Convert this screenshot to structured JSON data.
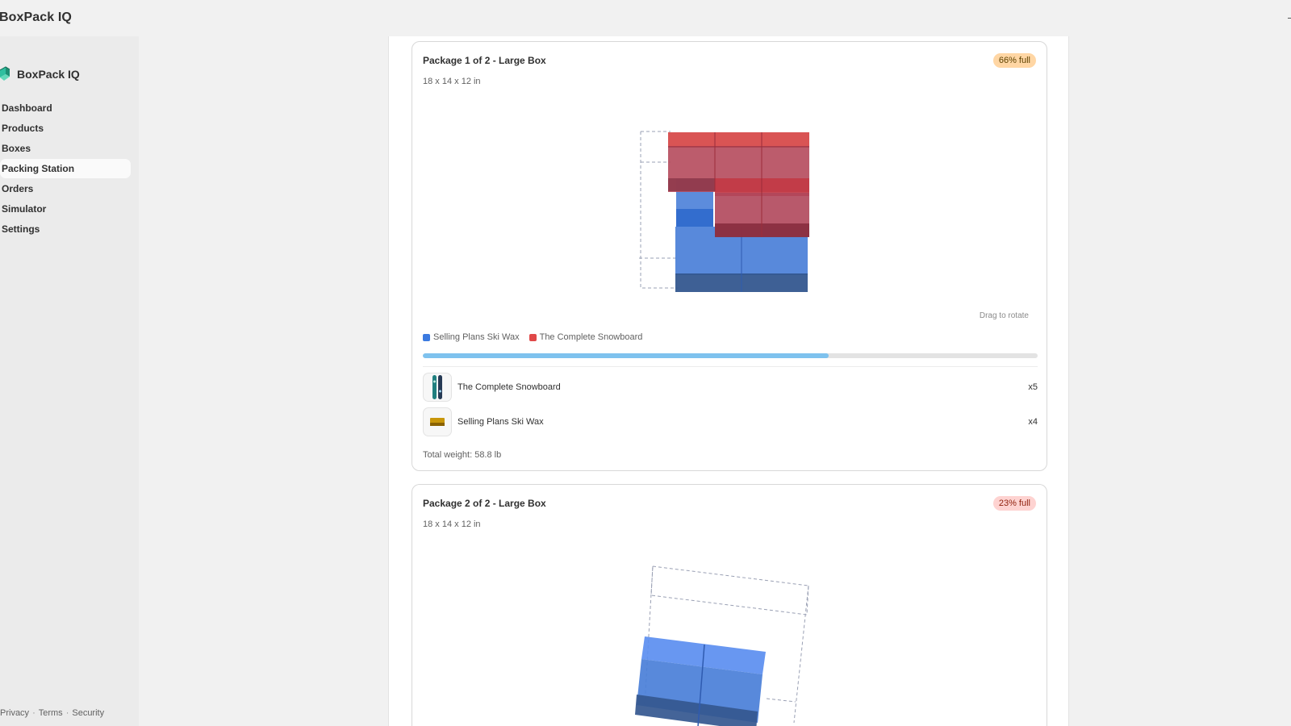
{
  "app": {
    "title": "BoxPack IQ"
  },
  "sidebar": {
    "brand": "BoxPack IQ",
    "items": [
      {
        "label": "Dashboard",
        "active": false
      },
      {
        "label": "Products",
        "active": false
      },
      {
        "label": "Boxes",
        "active": false
      },
      {
        "label": "Packing Station",
        "active": true
      },
      {
        "label": "Orders",
        "active": false
      },
      {
        "label": "Simulator",
        "active": false
      },
      {
        "label": "Settings",
        "active": false
      }
    ],
    "footer": {
      "privacy": "Privacy",
      "sep1": "·",
      "terms": "Terms",
      "sep2": "·",
      "security": "Security"
    }
  },
  "packages": [
    {
      "title": "Package 1 of 2 - Large Box",
      "dims": "18 x 14 x 12 in",
      "fill_badge": "66% full",
      "fill_fraction": 0.66,
      "drag_hint": "Drag to rotate",
      "legend": [
        {
          "label": "Selling Plans Ski Wax",
          "color": "#3b7ae0"
        },
        {
          "label": "The Complete Snowboard",
          "color": "#e04848"
        }
      ],
      "items": [
        {
          "name": "The Complete Snowboard",
          "qty": "x5",
          "icon": "snowboard-icon"
        },
        {
          "name": "Selling Plans Ski Wax",
          "qty": "x4",
          "icon": "ski-wax-icon"
        }
      ],
      "weight": "Total weight: 58.8 lb"
    },
    {
      "title": "Package 2 of 2 - Large Box",
      "dims": "18 x 14 x 12 in",
      "fill_badge": "23% full"
    }
  ],
  "colors": {
    "ski_wax": "#3b7ae0",
    "snowboard": "#e04848",
    "progress": "#7ec2ee",
    "badge_warning": "#ffd6a4",
    "badge_critical": "#fed3d1"
  }
}
